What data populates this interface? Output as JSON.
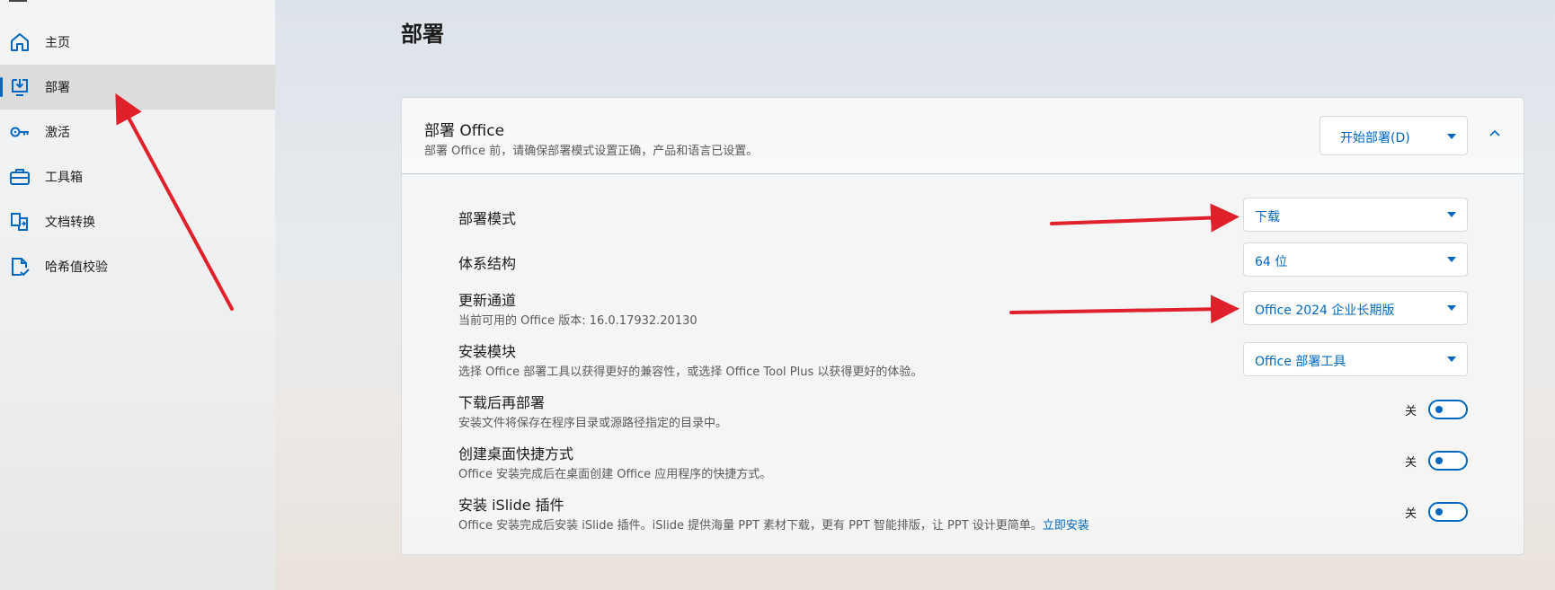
{
  "sidebar": {
    "items": [
      {
        "label": "主页",
        "icon": "home-icon"
      },
      {
        "label": "部署",
        "icon": "deploy-icon",
        "selected": true
      },
      {
        "label": "激活",
        "icon": "key-icon"
      },
      {
        "label": "工具箱",
        "icon": "toolbox-icon"
      },
      {
        "label": "文档转换",
        "icon": "document-convert-icon"
      },
      {
        "label": "哈希值校验",
        "icon": "file-check-icon"
      }
    ]
  },
  "page": {
    "title": "部署"
  },
  "card": {
    "title": "部署 Office",
    "description": "部署 Office 前，请确保部署模式设置正确，产品和语言已设置。",
    "start_button": "开始部署(D)"
  },
  "settings": {
    "mode": {
      "title": "部署模式",
      "value": "下载"
    },
    "arch": {
      "title": "体系结构",
      "value": "64 位"
    },
    "channel": {
      "title": "更新通道",
      "desc": "当前可用的 Office 版本: 16.0.17932.20130",
      "value": "Office 2024 企业长期版"
    },
    "module": {
      "title": "安装模块",
      "desc": "选择 Office 部署工具以获得更好的兼容性，或选择 Office Tool Plus 以获得更好的体验。",
      "value": "Office 部署工具"
    },
    "download_first": {
      "title": "下载后再部署",
      "desc": "安装文件将保存在程序目录或源路径指定的目录中。",
      "state": "关"
    },
    "shortcut": {
      "title": "创建桌面快捷方式",
      "desc": "Office 安装完成后在桌面创建 Office 应用程序的快捷方式。",
      "state": "关"
    },
    "islide": {
      "title": "安装 iSlide 插件",
      "desc": "Office 安装完成后安装 iSlide 插件。iSlide 提供海量 PPT 素材下载，更有 PPT 智能排版，让 PPT 设计更简单。",
      "link": "立即安装",
      "state": "关"
    }
  },
  "colors": {
    "accent": "#0067c0",
    "annotation_arrow": "#e0202a"
  }
}
